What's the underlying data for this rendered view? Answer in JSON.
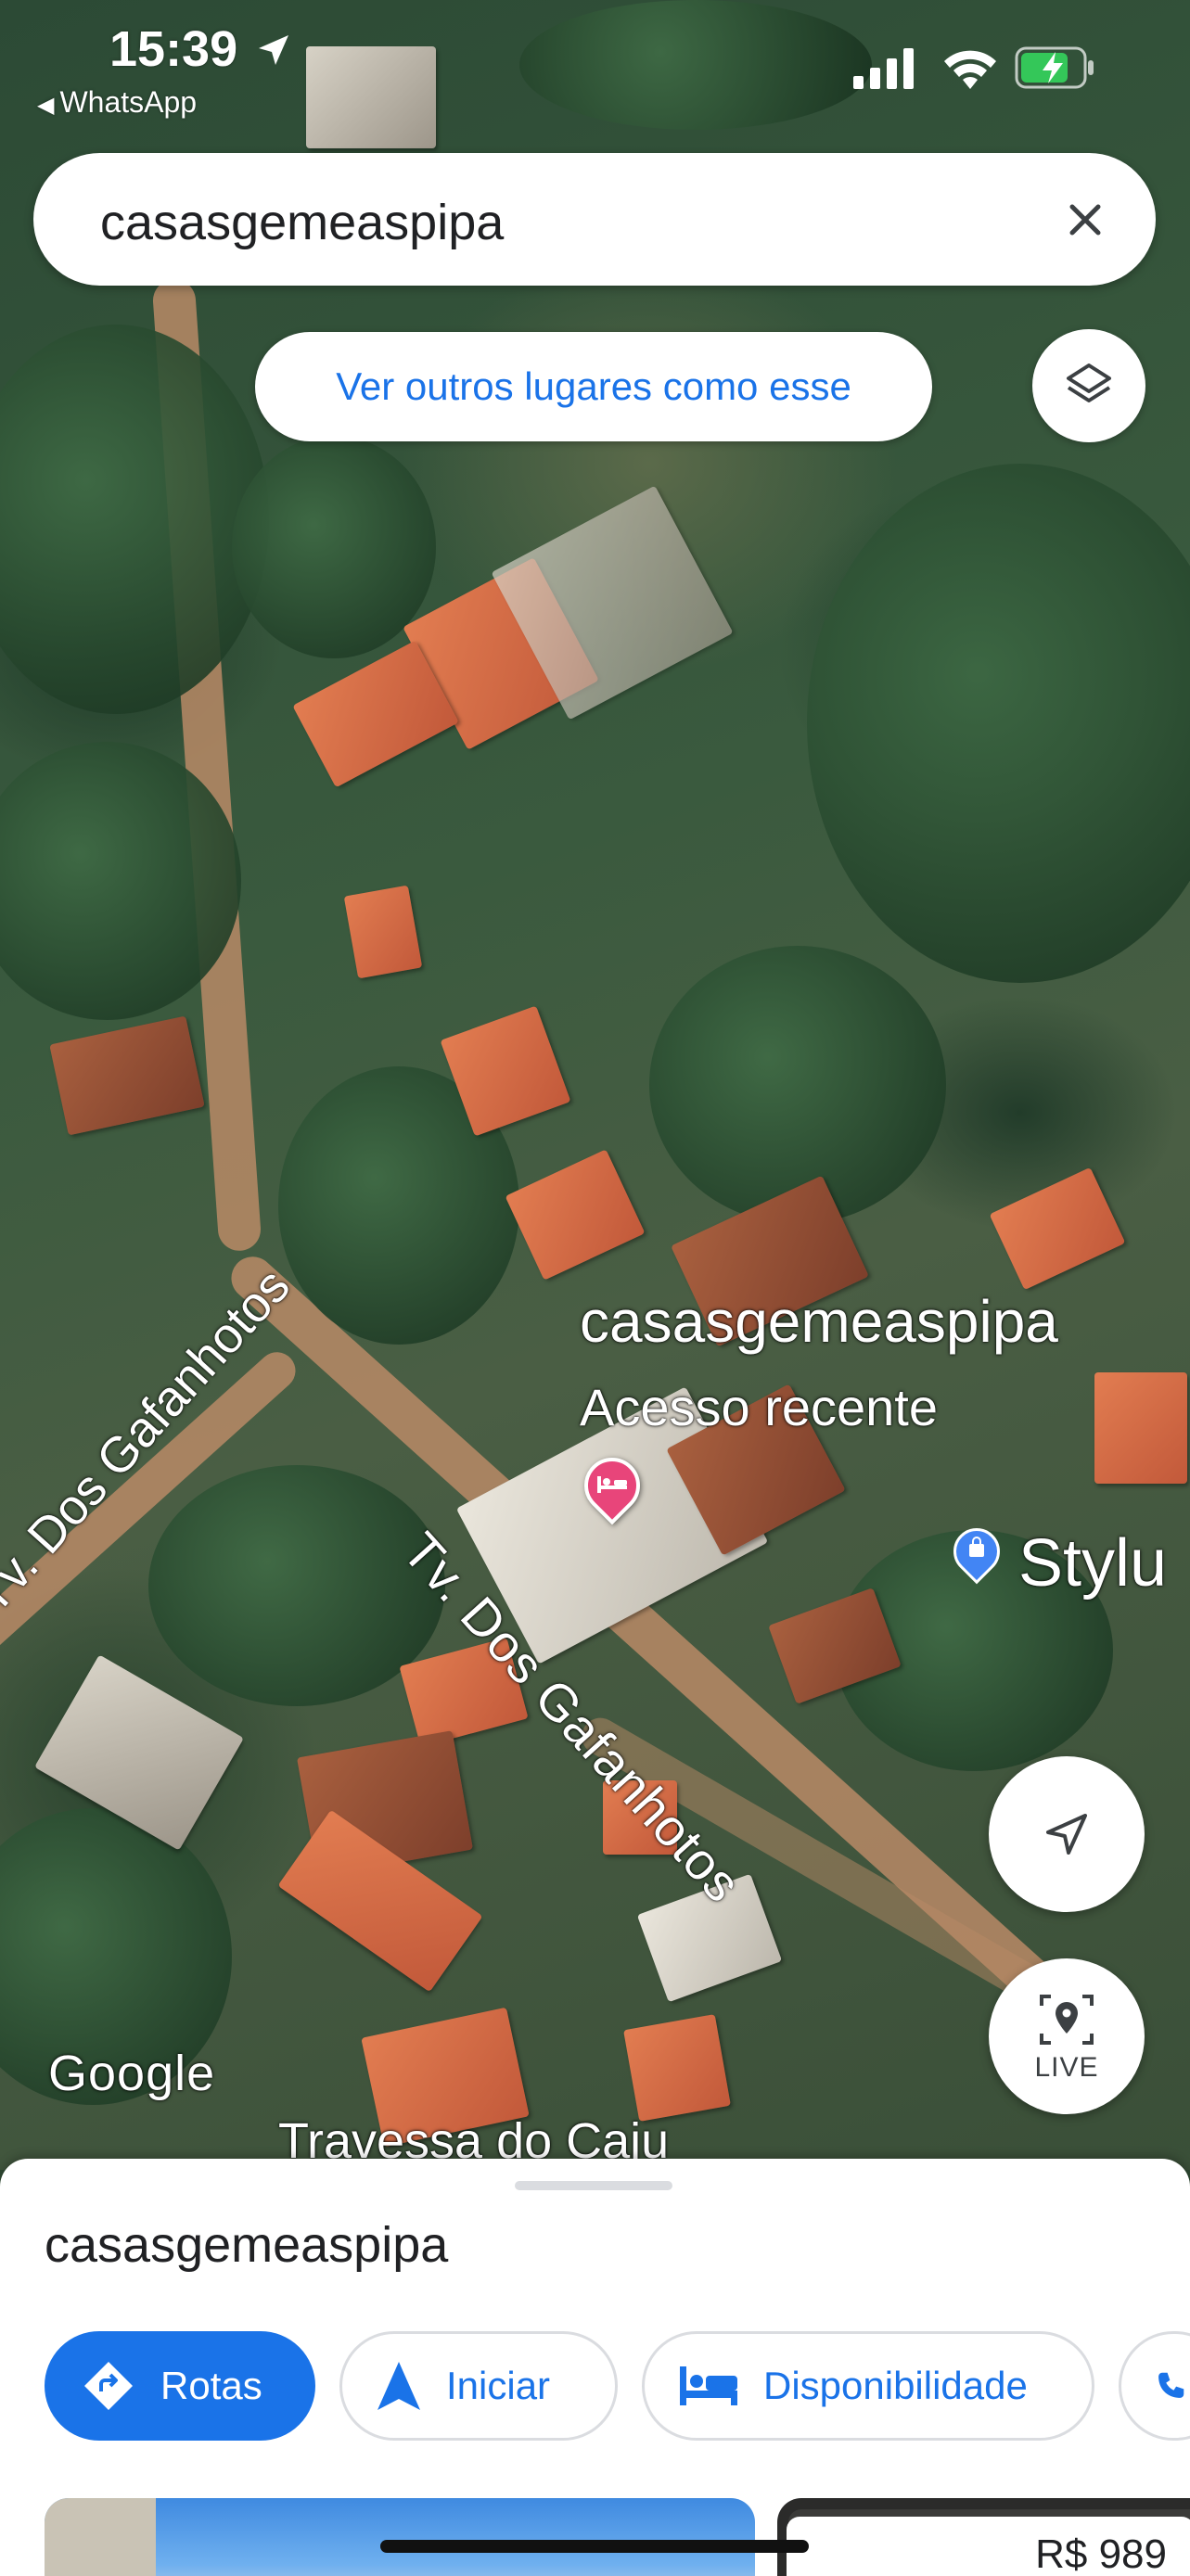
{
  "status_bar": {
    "time": "15:39",
    "back_app": "WhatsApp"
  },
  "search": {
    "query": "casasgemeaspipa",
    "close_icon": "close-icon"
  },
  "chips": {
    "similar_places": "Ver outros lugares como esse",
    "layers_icon": "layers-icon"
  },
  "map": {
    "streets": {
      "main": "Tv. Dos Gafanhotos",
      "left": "Tv. Dos Gafanhotos",
      "bottom": "Travessa do Caju"
    },
    "place": {
      "name": "casasgemeaspipa",
      "subtitle": "Acesso recente",
      "pin_icon": "hotel-bed-icon",
      "pin_color": "#e8457a"
    },
    "nearby_place": {
      "name": "Stylu",
      "icon": "shopping-bag-icon",
      "pin_color": "#4285f4"
    },
    "attribution": "Google"
  },
  "controls": {
    "compass_icon": "navigation-arrow-icon",
    "live_label": "LIVE"
  },
  "sheet": {
    "title": "casasgemeaspipa",
    "actions": [
      {
        "label": "Rotas",
        "icon": "directions-icon"
      },
      {
        "label": "Iniciar",
        "icon": "navigation-icon"
      },
      {
        "label": "Disponibilidade",
        "icon": "bed-icon"
      },
      {
        "label": "",
        "icon": "phone-icon"
      }
    ],
    "price": "R$ 989"
  },
  "colors": {
    "accent": "#1a73e8",
    "text": "#202124"
  }
}
